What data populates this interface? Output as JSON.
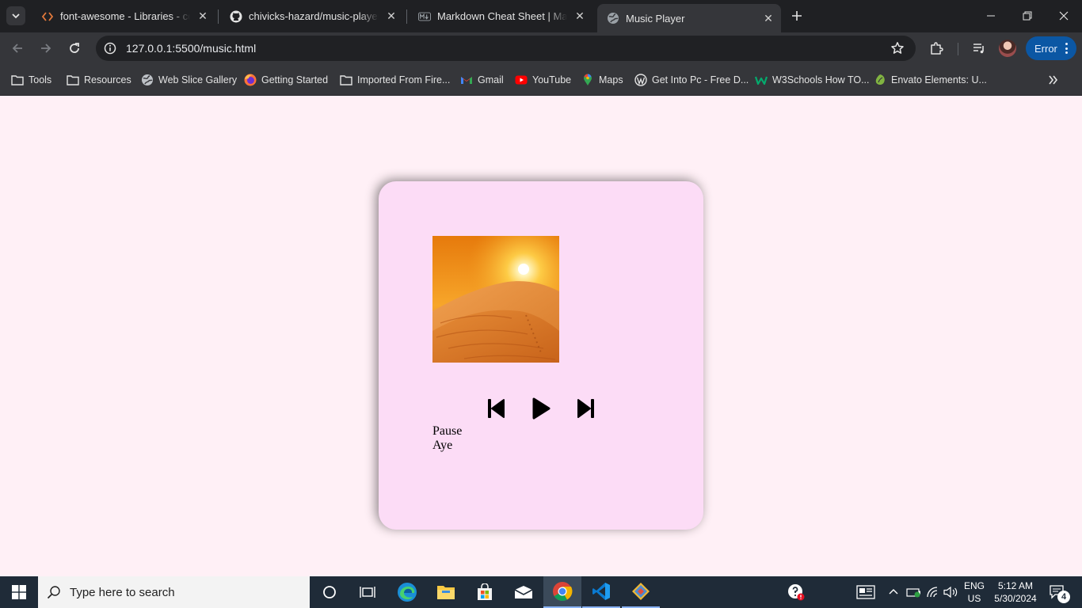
{
  "browser": {
    "tabs": [
      {
        "title": "font-awesome - Libraries - cdnjs",
        "icon": "code-brackets-icon",
        "active": false
      },
      {
        "title": "chivicks-hazard/music-player: A",
        "icon": "github-icon",
        "active": false
      },
      {
        "title": "Markdown Cheat Sheet | Markdown",
        "icon": "markdown-icon",
        "active": false
      },
      {
        "title": "Music Player",
        "icon": "globe-icon",
        "active": true
      }
    ],
    "url": "127.0.0.1:5500/music.html",
    "error_button_label": "Error",
    "bookmarks": [
      {
        "label": "Tools",
        "icon": "folder-icon"
      },
      {
        "label": "Resources",
        "icon": "folder-icon"
      },
      {
        "label": "Web Slice Gallery",
        "icon": "globe-icon"
      },
      {
        "label": "Getting Started",
        "icon": "firefox-icon"
      },
      {
        "label": "Imported From Fire...",
        "icon": "folder-icon"
      },
      {
        "label": "Gmail",
        "icon": "gmail-icon"
      },
      {
        "label": "YouTube",
        "icon": "youtube-icon"
      },
      {
        "label": "Maps",
        "icon": "maps-icon"
      },
      {
        "label": "Get Into Pc - Free D...",
        "icon": "wordpress-icon"
      },
      {
        "label": "W3Schools How TO...",
        "icon": "w3schools-icon"
      },
      {
        "label": "Envato Elements: U...",
        "icon": "envato-icon"
      }
    ]
  },
  "player": {
    "song_title": "Pause",
    "artist": "Aye",
    "controls": [
      "previous-track",
      "play",
      "next-track"
    ],
    "accent_color": "#fcdcf6",
    "page_background": "#fff0f6"
  },
  "taskbar": {
    "search_placeholder": "Type here to search",
    "language": "ENG",
    "region": "US",
    "time": "5:12 AM",
    "date": "5/30/2024",
    "notification_count": "4"
  }
}
